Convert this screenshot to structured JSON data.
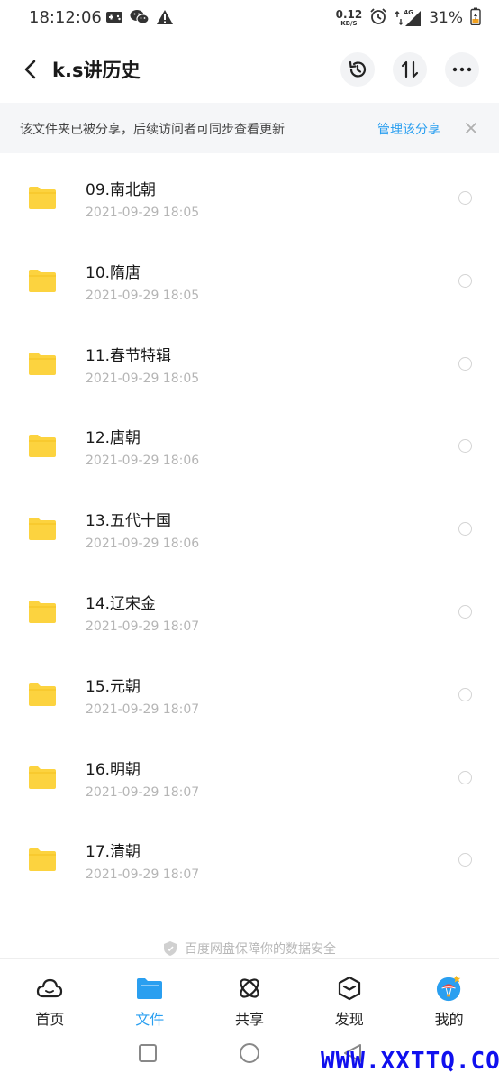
{
  "status_bar": {
    "time": "18:12:06",
    "net_speed_value": "0.12",
    "net_speed_unit": "KB/S",
    "network_type": "4G",
    "battery": "31%"
  },
  "header": {
    "title": "k.s讲历史"
  },
  "banner": {
    "text": "该文件夹已被分享，后续访问者可同步查看更新",
    "link": "管理该分享"
  },
  "files": [
    {
      "name": "09.南北朝",
      "date": "2021-09-29  18:05"
    },
    {
      "name": "10.隋唐",
      "date": "2021-09-29  18:05"
    },
    {
      "name": "11.春节特辑",
      "date": "2021-09-29  18:05"
    },
    {
      "name": "12.唐朝",
      "date": "2021-09-29  18:06"
    },
    {
      "name": "13.五代十国",
      "date": "2021-09-29  18:06"
    },
    {
      "name": "14.辽宋金",
      "date": "2021-09-29  18:07"
    },
    {
      "name": "15.元朝",
      "date": "2021-09-29  18:07"
    },
    {
      "name": "16.明朝",
      "date": "2021-09-29  18:07"
    },
    {
      "name": "17.清朝",
      "date": "2021-09-29  18:07"
    }
  ],
  "safety_note": "百度网盘保障你的数据安全",
  "bottom_nav": {
    "items": [
      {
        "label": "首页",
        "icon": "cloud-icon"
      },
      {
        "label": "文件",
        "icon": "folder-icon"
      },
      {
        "label": "共享",
        "icon": "share-atom-icon"
      },
      {
        "label": "发现",
        "icon": "discover-cube-icon"
      },
      {
        "label": "我的",
        "icon": "avatar-icon"
      }
    ],
    "active_index": 1
  },
  "watermark": "WWW.XXTTQ.COM",
  "colors": {
    "accent": "#2a9ff0",
    "folder": "#fcd33f",
    "banner_bg": "#f5f6f8",
    "date_text": "#b5b5b5"
  }
}
